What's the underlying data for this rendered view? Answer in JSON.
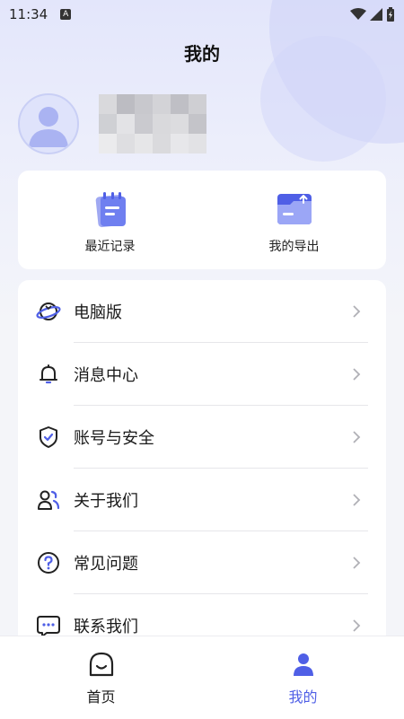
{
  "status_bar": {
    "time": "11:34",
    "notif_icon": "a-icon",
    "icons": [
      "wifi-icon",
      "signal-icon",
      "battery-icon"
    ]
  },
  "page": {
    "title": "我的"
  },
  "profile": {
    "avatar_icon": "user-avatar-icon",
    "nickname_blurred": true
  },
  "quick_actions": [
    {
      "label": "最近记录",
      "icon": "notebook-icon"
    },
    {
      "label": "我的导出",
      "icon": "folder-export-icon"
    }
  ],
  "menu": [
    {
      "label": "电脑版",
      "icon": "planet-icon"
    },
    {
      "label": "消息中心",
      "icon": "bell-icon"
    },
    {
      "label": "账号与安全",
      "icon": "shield-check-icon"
    },
    {
      "label": "关于我们",
      "icon": "people-icon"
    },
    {
      "label": "常见问题",
      "icon": "question-icon"
    },
    {
      "label": "联系我们",
      "icon": "chat-icon"
    }
  ],
  "tabbar": [
    {
      "label": "首页",
      "icon": "home-face-icon",
      "active": false
    },
    {
      "label": "我的",
      "icon": "profile-icon",
      "active": true
    }
  ],
  "colors": {
    "accent": "#4f5fe6",
    "text": "#1a1a1a",
    "muted": "#9a9aa2",
    "background": "#f4f5f9"
  }
}
